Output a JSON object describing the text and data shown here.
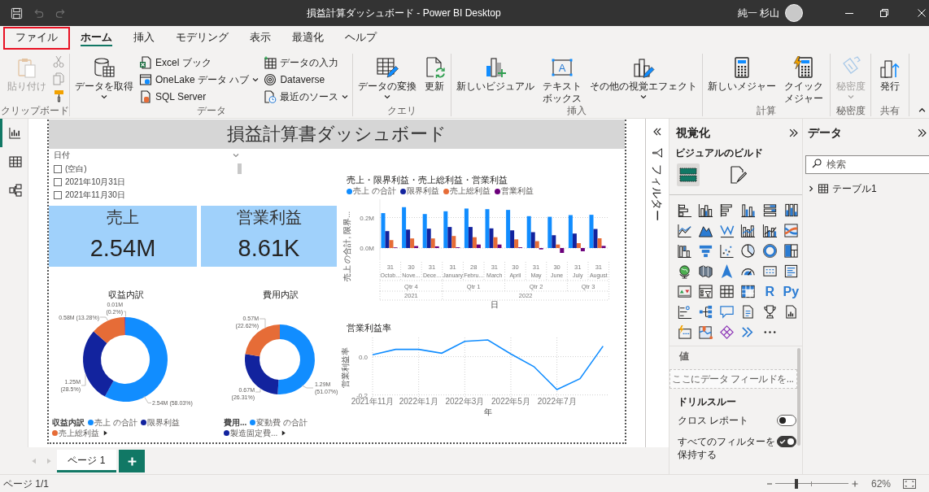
{
  "window": {
    "title": "損益計算ダッシュボード - Power BI Desktop",
    "user_name": "純一 杉山"
  },
  "quick_access": [
    {
      "disabled": false
    },
    {
      "disabled": true
    },
    {
      "disabled": true
    }
  ],
  "menu_tabs": [
    {
      "label": "ファイル",
      "selected": false,
      "outlined": true
    },
    {
      "label": "ホーム",
      "selected": true,
      "outlined": false
    },
    {
      "label": "挿入",
      "selected": false,
      "outlined": false
    },
    {
      "label": "モデリング",
      "selected": false,
      "outlined": false
    },
    {
      "label": "表示",
      "selected": false,
      "outlined": false
    },
    {
      "label": "最適化",
      "selected": false,
      "outlined": false
    },
    {
      "label": "ヘルプ",
      "selected": false,
      "outlined": false
    }
  ],
  "ribbon": {
    "clipboard": {
      "label": "クリップボード",
      "paste": {
        "label": "貼り付け",
        "disabled": true
      },
      "tools": [
        {
          "disabled": true
        },
        {
          "disabled": true
        },
        {
          "disabled": false
        }
      ]
    },
    "data": {
      "label": "データ",
      "get_data": {
        "label": "データを取得",
        "dropdown": true,
        "disabled": false
      },
      "sources": [
        {
          "label": "Excel ブック",
          "dropdown": false
        },
        {
          "label": "OneLake データ ハブ",
          "dropdown": true
        },
        {
          "label": "SQL Server",
          "dropdown": false
        },
        {
          "label": "データの入力",
          "dropdown": false
        },
        {
          "label": "Dataverse",
          "dropdown": false
        },
        {
          "label": "最近のソース",
          "dropdown": true
        }
      ]
    },
    "queries": {
      "label": "クエリ",
      "buttons": [
        {
          "label": "データの変換",
          "dropdown": true,
          "disabled": false
        },
        {
          "label": "更新",
          "dropdown": false,
          "disabled": false
        }
      ]
    },
    "insert": {
      "label": "挿入",
      "buttons": [
        {
          "label": "新しいビジュアル",
          "dropdown": false,
          "disabled": false
        },
        {
          "label": "テキストボックス",
          "dropdown": false,
          "disabled": false,
          "icon_text": "A"
        },
        {
          "label": "その他の視覚エフェクト",
          "dropdown": true,
          "disabled": false
        }
      ]
    },
    "calculations": {
      "label": "計算",
      "buttons": [
        {
          "label": "新しいメジャー",
          "dropdown": false,
          "disabled": false
        },
        {
          "label": "クイックメジャー",
          "dropdown": false,
          "disabled": false
        }
      ]
    },
    "sensitivity": {
      "label": "秘密度",
      "buttons": [
        {
          "label": "秘密度",
          "dropdown": true,
          "disabled": true
        }
      ]
    },
    "share": {
      "label": "共有",
      "buttons": [
        {
          "label": "発行",
          "dropdown": false,
          "disabled": false
        }
      ]
    }
  },
  "view_switcher": [
    {
      "selected": true
    },
    {
      "selected": false
    },
    {
      "selected": false
    }
  ],
  "report": {
    "title": "損益計算書ダッシュボード",
    "slicer": {
      "title": "日付",
      "items": [
        {
          "label": "(空白)",
          "checked": false
        },
        {
          "label": "2021年10月31日",
          "checked": false
        },
        {
          "label": "2021年11月30日",
          "checked": false
        }
      ]
    },
    "cards": [
      {
        "label": "売上",
        "value": "2.54M"
      },
      {
        "label": "営業利益",
        "value": "8.61K"
      }
    ],
    "donuts": [
      {
        "chart_data": {
          "type": "donut",
          "title": "収益内訳",
          "values": [
            2540000,
            1250000,
            580000,
            10000
          ],
          "value_labels": [
            "2.54M (58.03%)",
            "1.25M (28.5%)",
            "0.58M (13.28%)",
            "0.01M (0.2%)"
          ],
          "colors": [
            "#118dff",
            "#12239e",
            "#e66c37",
            "#6b007b"
          ]
        },
        "legend": {
          "title": "収益内訳",
          "items": [
            {
              "label": "売上 の合計",
              "color": "#118dff"
            },
            {
              "label": "限界利益",
              "color": "#12239e"
            },
            {
              "label": "売上総利益",
              "color": "#e66c37"
            }
          ],
          "more": true
        }
      },
      {
        "chart_data": {
          "type": "donut",
          "title": "費用内訳",
          "values": [
            1290000,
            670000,
            570000
          ],
          "value_labels": [
            "1.29M (51.07%)",
            "0.67M (26.31%)",
            "0.57M (22.62%)"
          ],
          "colors": [
            "#118dff",
            "#12239e",
            "#e66c37"
          ]
        },
        "legend": {
          "title": "費用...",
          "items": [
            {
              "label": "変動費 の合計",
              "color": "#118dff"
            },
            {
              "label": "製造固定費...",
              "color": "#12239e"
            }
          ],
          "more": true
        }
      }
    ],
    "bar_chart": {
      "chart_data": {
        "type": "bar",
        "title": "売上・限界利益・売上総利益・営業利益",
        "xlabel": "日",
        "ylabel": "売上 の合計, 限界...",
        "legend": "top",
        "grid": true,
        "categories": [
          "Octob...",
          "Nove...",
          "Dece...",
          "January",
          "Febru...",
          "March",
          "April",
          "May",
          "June",
          "July",
          "August"
        ],
        "series": [
          {
            "name": "売上 の合計",
            "color": "#118dff",
            "values": [
              229000,
              268000,
              223000,
              241000,
              259000,
              255000,
              250000,
              209000,
              205000,
              216000,
              218000
            ]
          },
          {
            "name": "限界利益",
            "color": "#12239e",
            "values": [
              111000,
              121000,
              127000,
              138000,
              138000,
              129000,
              116000,
              104000,
              84000,
              95000,
              125000
            ]
          },
          {
            "name": "売上総利益",
            "color": "#e66c37",
            "values": [
              52000,
              63000,
              63000,
              79000,
              71000,
              71000,
              57000,
              45000,
              23000,
              32000,
              64000
            ]
          },
          {
            "name": "営業利益",
            "color": "#6b007b",
            "values": [
              4000,
              13000,
              11000,
              5000,
              23000,
              23000,
              5000,
              -9000,
              -32000,
              -21000,
              14000
            ]
          }
        ],
        "ylim": [
          -80000,
          320000
        ],
        "yticks": [
          {
            "value": 0,
            "label": "0.0M"
          },
          {
            "value": 200000,
            "label": "0.2M"
          }
        ]
      },
      "x_axis_levels": [
        {
          "label": "2021",
          "children": [
            {
              "label": "Qtr 4",
              "children": [
                {
                  "label": "31"
                },
                {
                  "label": "30"
                },
                {
                  "label": "31"
                }
              ]
            }
          ]
        },
        {
          "label": "2022",
          "children": [
            {
              "label": "Qtr 1",
              "children": [
                {
                  "label": "31"
                },
                {
                  "label": "28"
                },
                {
                  "label": "31"
                }
              ]
            },
            {
              "label": "Qtr 2",
              "children": [
                {
                  "label": "30"
                },
                {
                  "label": "31"
                },
                {
                  "label": "30"
                }
              ]
            },
            {
              "label": "Qtr 3",
              "children": [
                {
                  "label": "31"
                },
                {
                  "label": "31"
                }
              ]
            }
          ]
        }
      ]
    },
    "line_chart": {
      "chart_data": {
        "type": "line",
        "title": "営業利益率",
        "xlabel": "年",
        "ylabel": "営業利益率",
        "grid": true,
        "categories": [
          "2021年11月",
          null,
          "2022年1月",
          null,
          "2022年3月",
          null,
          "2022年5月",
          null,
          "2022年7月",
          null,
          null
        ],
        "series": [
          {
            "color": "#118dff",
            "values": [
              0.01,
              0.038,
              0.038,
              0.018,
              0.08,
              0.087,
              0.014,
              -0.052,
              -0.172,
              -0.115,
              0.055
            ]
          }
        ],
        "ylim": [
          -0.21,
          0.1
        ],
        "yticks": [
          {
            "value": 0,
            "label": "0.0"
          },
          {
            "value": -0.2,
            "label": "-0.2"
          }
        ]
      }
    }
  },
  "filters_pane": {
    "title": "フィルター"
  },
  "visualizations_pane": {
    "title": "視覚化",
    "subtitle": "ビジュアルのビルド",
    "build_tabs": [
      {
        "selected": true
      },
      {
        "selected": false
      }
    ],
    "script_visuals": [
      "R",
      "Py"
    ],
    "well": {
      "title": "値",
      "placeholder": "ここにデータ フィールドを..."
    },
    "drillthrough": {
      "title": "ドリルスルー",
      "toggles": [
        {
          "label": "クロス レポート",
          "on": false
        },
        {
          "label": "すべてのフィルターを保持する",
          "on": true
        }
      ]
    }
  },
  "data_pane": {
    "title": "データ",
    "search": {
      "placeholder": "検索"
    },
    "tree": [
      {
        "label": "テーブル1",
        "expanded": false
      }
    ]
  },
  "page_tabs": [
    {
      "label": "ページ 1",
      "selected": true
    }
  ],
  "status_bar": {
    "page": "ページ 1/1",
    "zoom": {
      "level": 0.29,
      "reading": "62%"
    }
  }
}
